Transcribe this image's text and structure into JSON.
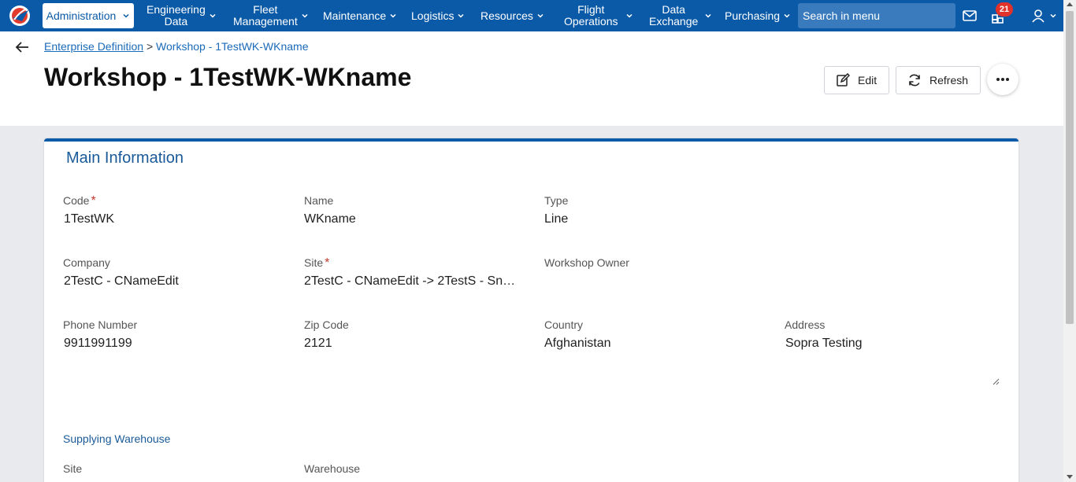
{
  "nav": {
    "admin": "Administration",
    "items": [
      {
        "label1": "Engineering",
        "label2": "Data"
      },
      {
        "label1": "Fleet",
        "label2": "Management"
      },
      {
        "label1": "Maintenance",
        "label2": ""
      },
      {
        "label1": "Logistics",
        "label2": ""
      },
      {
        "label1": "Resources",
        "label2": ""
      },
      {
        "label1": "Flight",
        "label2": "Operations"
      },
      {
        "label1": "Data",
        "label2": "Exchange"
      },
      {
        "label1": "Purchasing",
        "label2": ""
      }
    ],
    "search_placeholder": "Search in menu",
    "notification_count": "21"
  },
  "breadcrumb": {
    "link": "Enterprise Definition",
    "separator": ">",
    "current": "Workshop - 1TestWK-WKname"
  },
  "page_title": "Workshop - 1TestWK-WKname",
  "toolbar": {
    "edit_label": "Edit",
    "refresh_label": "Refresh"
  },
  "main_info": {
    "title": "Main Information",
    "code_label": "Code",
    "code_value": "1TestWK",
    "name_label": "Name",
    "name_value": "WKname",
    "type_label": "Type",
    "type_value": "Line",
    "company_label": "Company",
    "company_value": "2TestC - CNameEdit",
    "site_label": "Site",
    "site_value": "2TestC - CNameEdit -> 2TestS - Sna...",
    "owner_label": "Workshop Owner",
    "phone_label": "Phone Number",
    "phone_value": "9911991199",
    "zip_label": "Zip Code",
    "zip_value": "2121",
    "country_label": "Country",
    "country_value": "Afghanistan",
    "address_label": "Address",
    "address_value": "Sopra Testing",
    "required_mark": "*"
  },
  "supplying": {
    "title": "Supplying Warehouse",
    "site_label": "Site",
    "warehouse_label": "Warehouse"
  },
  "colors": {
    "nav_bg": "#0a5aa8",
    "accent": "#1a5a98",
    "badge": "#e0312a"
  }
}
